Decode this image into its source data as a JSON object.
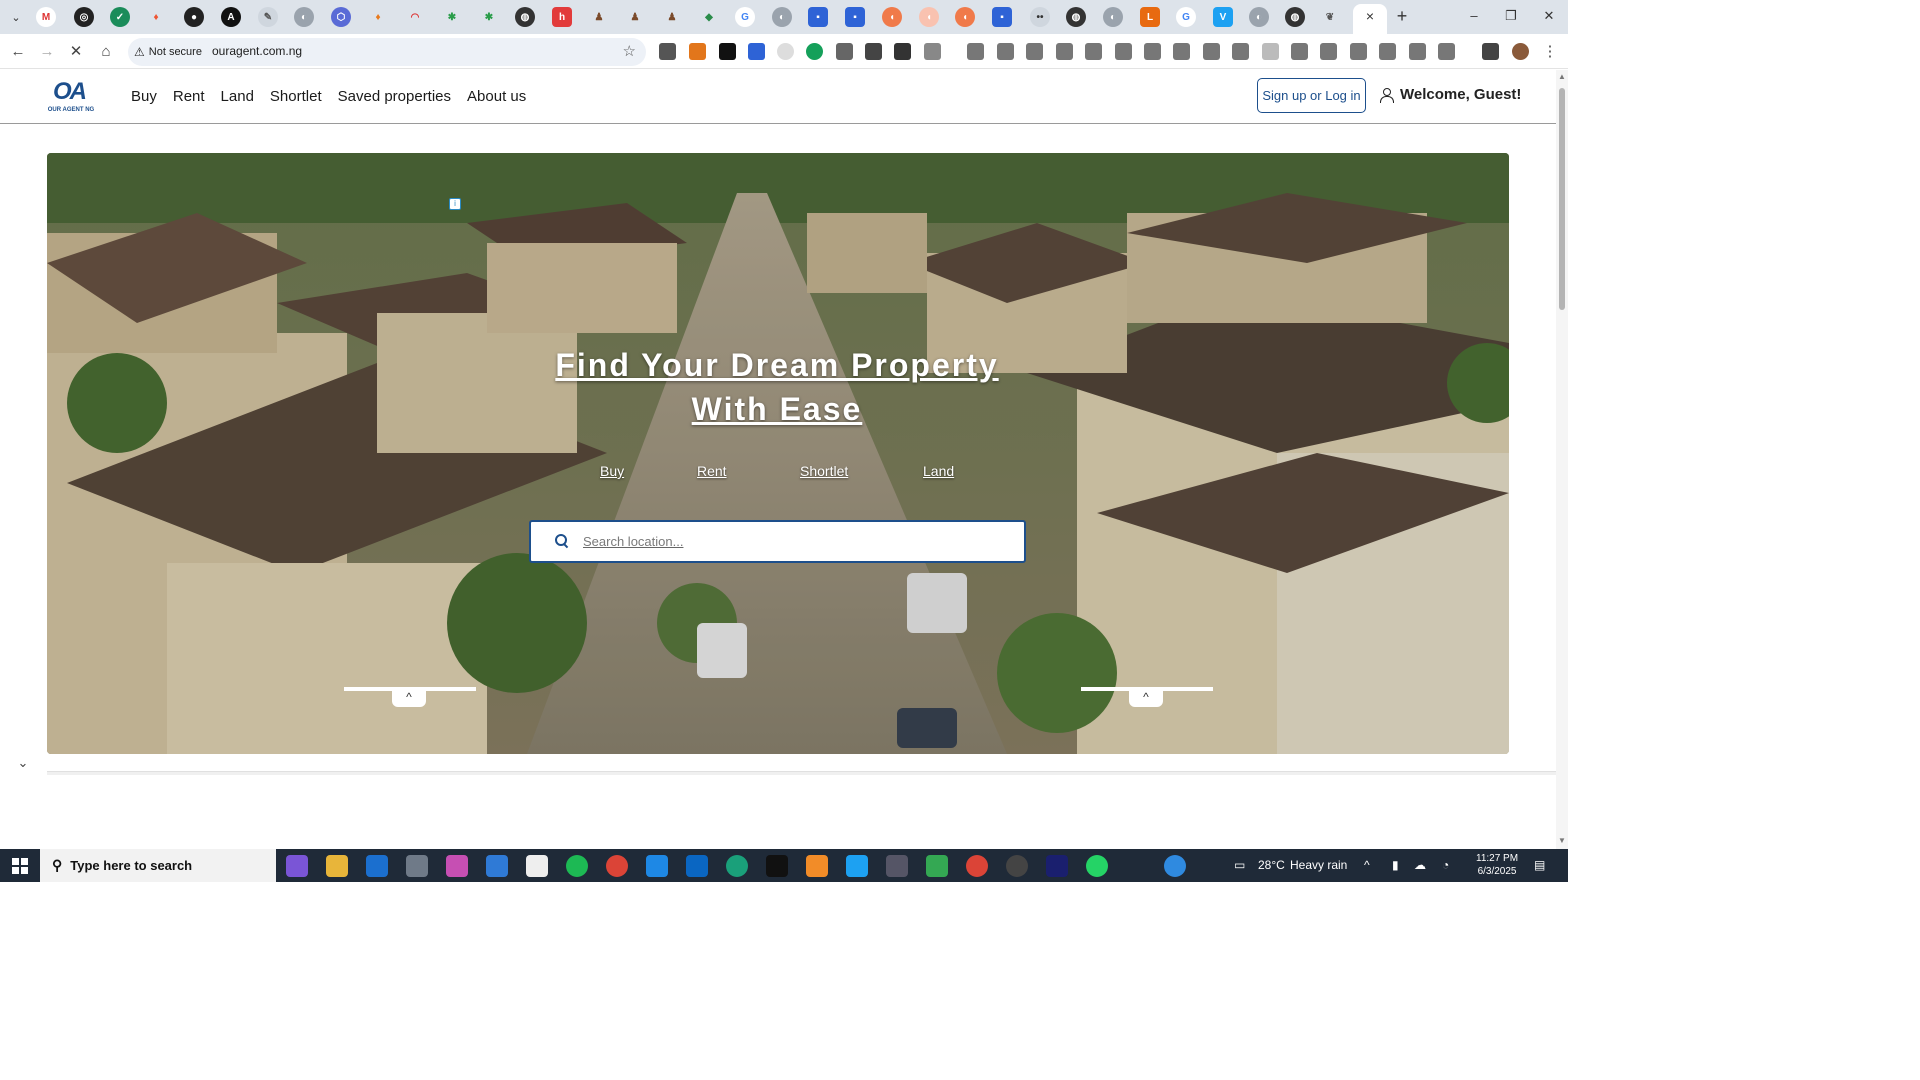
{
  "browser": {
    "menu_icon": "chevron-down-icon",
    "close_tab_icon": "×",
    "new_tab_icon": "+",
    "window": {
      "minimize": "–",
      "restore": "❐",
      "close": "✕"
    },
    "back_icon": "←",
    "forward_icon": "→",
    "reload_icon": "✕",
    "home_icon": "⌂",
    "security_chip": "Not secure",
    "url": "ouragent.com.ng",
    "bookmark_icon": "☆"
  },
  "site": {
    "logo_mark": "OA",
    "logo_text": "OUR AGENT NG",
    "nav": [
      "Buy",
      "Rent",
      "Land",
      "Shortlet",
      "Saved properties",
      "About us"
    ],
    "signup_label": "Sign up or Log in",
    "welcome_text": "Welcome, Guest!"
  },
  "hero": {
    "ad_marker": "i",
    "title": "Find Your Dream Property With Ease",
    "tabs": [
      "Buy",
      "Rent",
      "Shortlet",
      "Land"
    ],
    "search_placeholder": "Search location...",
    "slider_icon": "^"
  },
  "page": {
    "collapse_icon": "⌄"
  },
  "taskbar": {
    "search_text": "Type here to search",
    "temperature": "28°C",
    "weather": "Heavy rain",
    "time": "11:27 PM",
    "date": "6/3/2025"
  },
  "colors": {
    "brand": "#1d4f8c",
    "tabstrip": "#dde3ea",
    "taskbar": "#1f2a38"
  }
}
